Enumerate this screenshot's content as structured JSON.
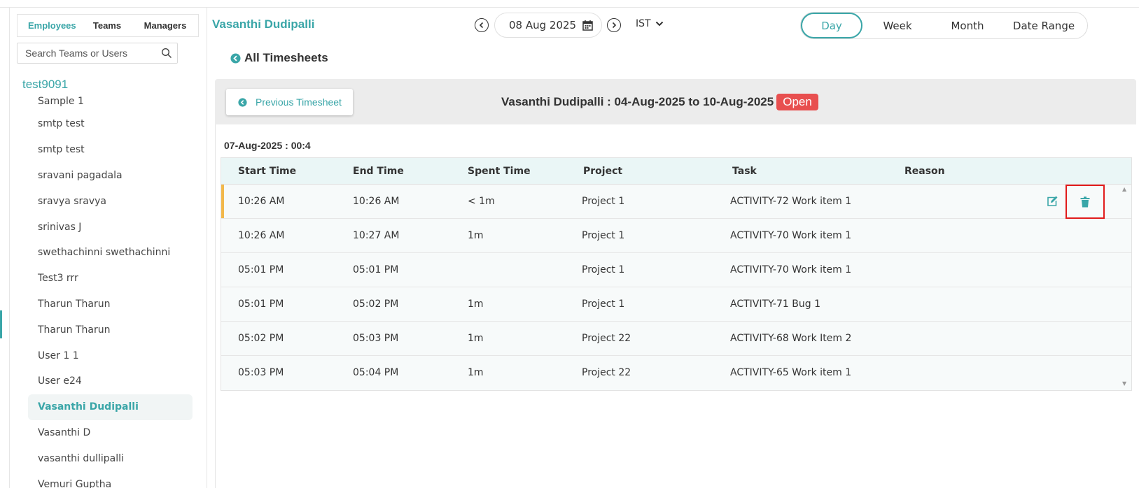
{
  "sidebar": {
    "tabs": [
      {
        "label": "Employees",
        "active": true
      },
      {
        "label": "Teams",
        "active": false
      },
      {
        "label": "Managers",
        "active": false
      }
    ],
    "search_placeholder": "Search Teams or Users",
    "group_title": "test9091",
    "users": [
      "Sample 1",
      "smtp test",
      "smtp test",
      "sravani pagadala",
      "sravya sravya",
      "srinivas J",
      "swethachinni swethachinni",
      "Test3 rrr",
      "Tharun Tharun",
      "Tharun Tharun",
      "User 1 1",
      "User e24",
      "Vasanthi Dudipalli",
      "Vasanthi D",
      "vasanthi dullipalli",
      "Vemuri Guptha"
    ],
    "selected_user": "Vasanthi Dudipalli"
  },
  "header": {
    "employee_name": "Vasanthi Dudipalli",
    "date": "08 Aug 2025",
    "timezone": "IST",
    "range_tabs": [
      "Day",
      "Week",
      "Month",
      "Date Range"
    ],
    "active_range": "Day",
    "back_link": "All Timesheets"
  },
  "banner": {
    "prev_button": "Previous Timesheet",
    "title": "Vasanthi Dudipalli : 04-Aug-2025 to 10-Aug-2025",
    "status": "Open"
  },
  "day_summary": "07-Aug-2025 : 00:4",
  "table": {
    "headers": [
      "Start Time",
      "End Time",
      "Spent Time",
      "Project",
      "Task",
      "Reason"
    ],
    "rows": [
      {
        "start": "10:26 AM",
        "end": "10:26 AM",
        "spent": "< 1m",
        "project": "Project 1",
        "task": "ACTIVITY-72 Work item 1",
        "reason": ""
      },
      {
        "start": "10:26 AM",
        "end": "10:27 AM",
        "spent": "1m",
        "project": "Project 1",
        "task": "ACTIVITY-70 Work item 1",
        "reason": ""
      },
      {
        "start": "05:01 PM",
        "end": "05:01 PM",
        "spent": "",
        "project": "Project 1",
        "task": "ACTIVITY-70 Work item 1",
        "reason": ""
      },
      {
        "start": "05:01 PM",
        "end": "05:02 PM",
        "spent": "1m",
        "project": "Project 1",
        "task": "ACTIVITY-71 Bug 1",
        "reason": ""
      },
      {
        "start": "05:02 PM",
        "end": "05:03 PM",
        "spent": "1m",
        "project": "Project 22",
        "task": "ACTIVITY-68 Work Item 2",
        "reason": ""
      },
      {
        "start": "05:03 PM",
        "end": "05:04 PM",
        "spent": "1m",
        "project": "Project 22",
        "task": "ACTIVITY-65 Work item 1",
        "reason": ""
      }
    ]
  },
  "colors": {
    "accent": "#3aa6a8",
    "status_open": "#e84f4f",
    "highlight_border": "#e11b1b",
    "row_marker": "#f2b84b"
  }
}
